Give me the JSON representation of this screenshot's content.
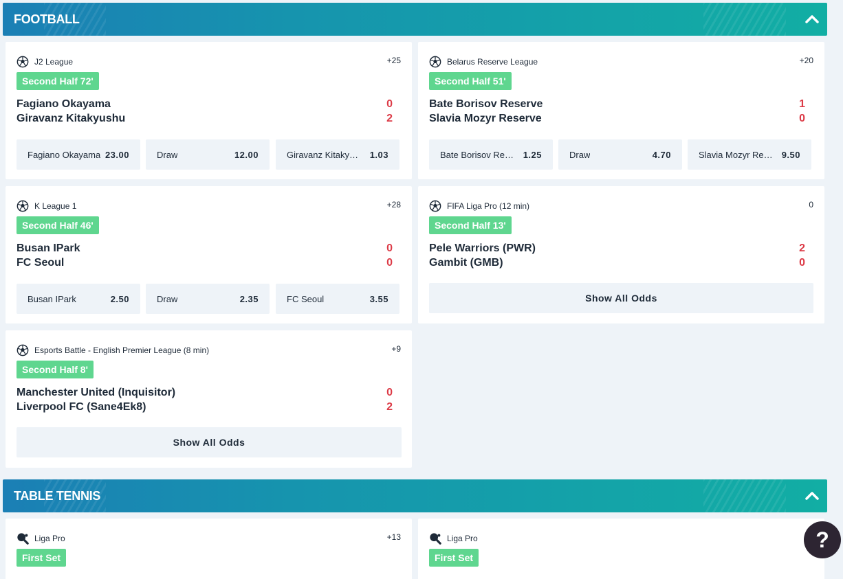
{
  "football": {
    "title": "FOOTBALL",
    "matches": [
      {
        "league": "J2 League",
        "more": "+25",
        "status": "Second Half 72'",
        "home": "Fagiano Okayama",
        "away": "Giravanz Kitakyushu",
        "home_score": "0",
        "away_score": "2",
        "odds": [
          {
            "label": "Fagiano Okayama",
            "value": "23.00"
          },
          {
            "label": "Draw",
            "value": "12.00"
          },
          {
            "label": "Giravanz Kitakyushu",
            "value": "1.03"
          }
        ]
      },
      {
        "league": "Belarus Reserve League",
        "more": "+20",
        "status": "Second Half 51'",
        "home": "Bate Borisov Reserve",
        "away": "Slavia Mozyr Reserve",
        "home_score": "1",
        "away_score": "0",
        "odds": [
          {
            "label": "Bate Borisov Reserve",
            "value": "1.25"
          },
          {
            "label": "Draw",
            "value": "4.70"
          },
          {
            "label": "Slavia Mozyr Reserve",
            "value": "9.50"
          }
        ]
      },
      {
        "league": "K League 1",
        "more": "+28",
        "status": "Second Half 46'",
        "home": "Busan IPark",
        "away": "FC Seoul",
        "home_score": "0",
        "away_score": "0",
        "odds": [
          {
            "label": "Busan IPark",
            "value": "2.50"
          },
          {
            "label": "Draw",
            "value": "2.35"
          },
          {
            "label": "FC Seoul",
            "value": "3.55"
          }
        ]
      },
      {
        "league": "FIFA Liga Pro (12 min)",
        "more": "0",
        "status": "Second Half 13'",
        "home": "Pele Warriors (PWR)",
        "away": "Gambit (GMB)",
        "home_score": "2",
        "away_score": "0",
        "show_all": "Show All Odds"
      },
      {
        "league": "Esports Battle - English Premier League (8 min)",
        "more": "+9",
        "status": "Second Half 8'",
        "home": "Manchester United (Inquisitor)",
        "away": "Liverpool FC (Sane4Ek8)",
        "home_score": "0",
        "away_score": "2",
        "show_all": "Show All Odds"
      }
    ]
  },
  "table_tennis": {
    "title": "TABLE TENNIS",
    "matches": [
      {
        "league": "Liga Pro",
        "more": "+13",
        "status": "First Set"
      },
      {
        "league": "Liga Pro",
        "more": "+",
        "status": "First Set"
      }
    ]
  },
  "help": {
    "label": "?"
  }
}
